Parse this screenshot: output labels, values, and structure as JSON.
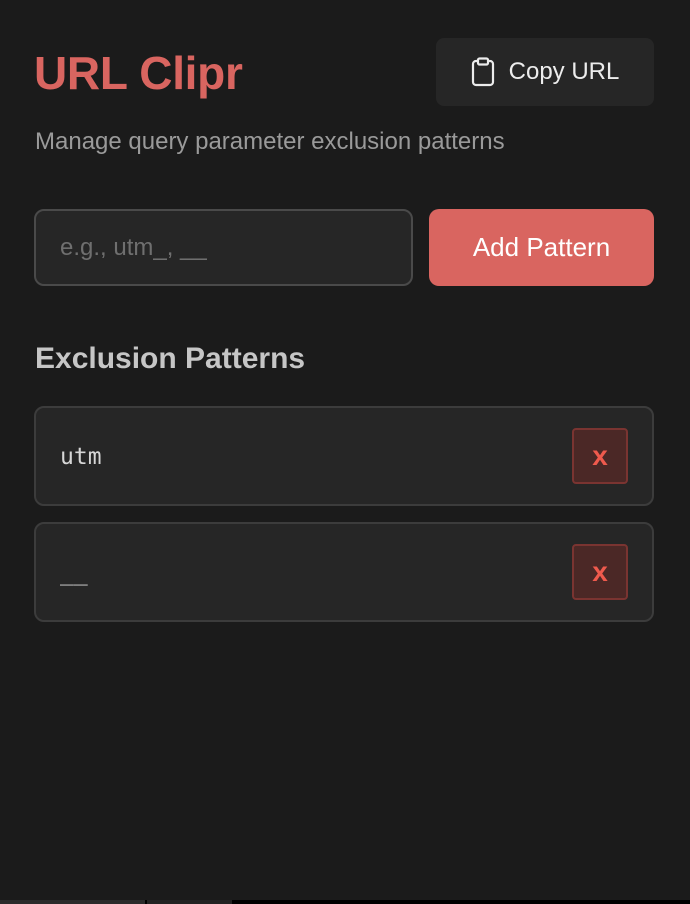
{
  "header": {
    "title": "URL Clipr",
    "copy_button": {
      "label": "Copy URL",
      "icon": "clipboard-icon"
    },
    "subtitle": "Manage query parameter exclusion patterns"
  },
  "add_form": {
    "input_value": "",
    "input_placeholder": "e.g., utm_, __",
    "add_button_label": "Add Pattern"
  },
  "patterns_section": {
    "title": "Exclusion Patterns",
    "items": [
      {
        "pattern": "utm",
        "delete_label": "x"
      },
      {
        "pattern": "__",
        "delete_label": "x"
      }
    ]
  },
  "colors": {
    "accent": "#d96560",
    "background": "#1b1b1b",
    "surface": "#262626",
    "delete_text": "#ef5a4d",
    "delete_bg": "#4b2826"
  }
}
